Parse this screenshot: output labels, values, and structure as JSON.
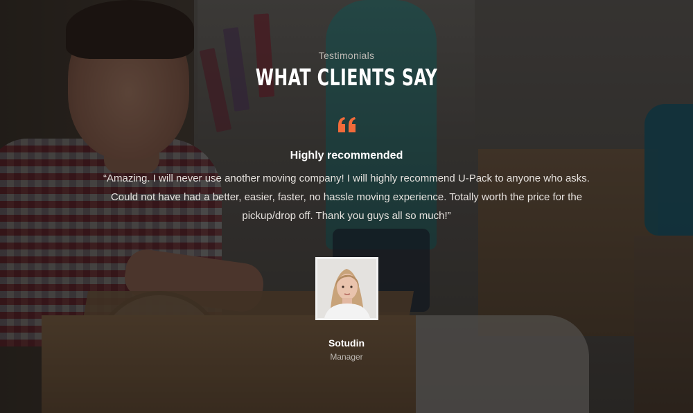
{
  "section": {
    "subtitle": "Testimonials",
    "title": "WHAT CLIENTS SAY"
  },
  "testimonial": {
    "quote_icon": "quote-icon",
    "heading": "Highly recommended",
    "text": "“Amazing. I will never use another moving company! I will highly recommend U-Pack to anyone who asks. Could not have had a better, easier, faster, no hassle moving experience. Totally worth the price for the pickup/drop off. Thank you guys all so much!”",
    "author": {
      "name": "Sotudin",
      "role": "Manager"
    }
  },
  "colors": {
    "accent": "#f26b3a",
    "title": "#ffffff",
    "overlay": "rgba(0,0,0,0.55)"
  }
}
